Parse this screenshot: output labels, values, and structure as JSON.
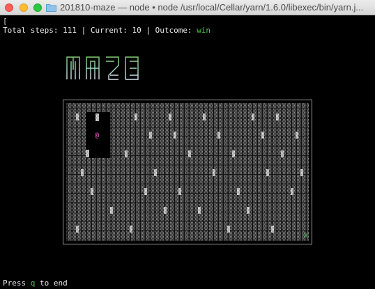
{
  "window": {
    "title": "201810-maze — node • node /usr/local/Cellar/yarn/1.6.0/libexec/bin/yarn.j..."
  },
  "terminal": {
    "top_mark": "[",
    "status": {
      "total_label": "Total steps: ",
      "total_value": "111",
      "sep1": " | ",
      "current_label": "Current: ",
      "current_value": "10",
      "sep2": " | ",
      "outcome_label": "Outcome: ",
      "outcome_value": "win"
    },
    "logo_text": "MAZE",
    "maze": {
      "player_glyph": "@",
      "exit_glyph": "X"
    },
    "footer": {
      "prefix": "Press ",
      "key": "q",
      "suffix": " to end"
    }
  },
  "colors": {
    "accent_green": "#4ec24e",
    "player_pink": "#e85fd4"
  }
}
